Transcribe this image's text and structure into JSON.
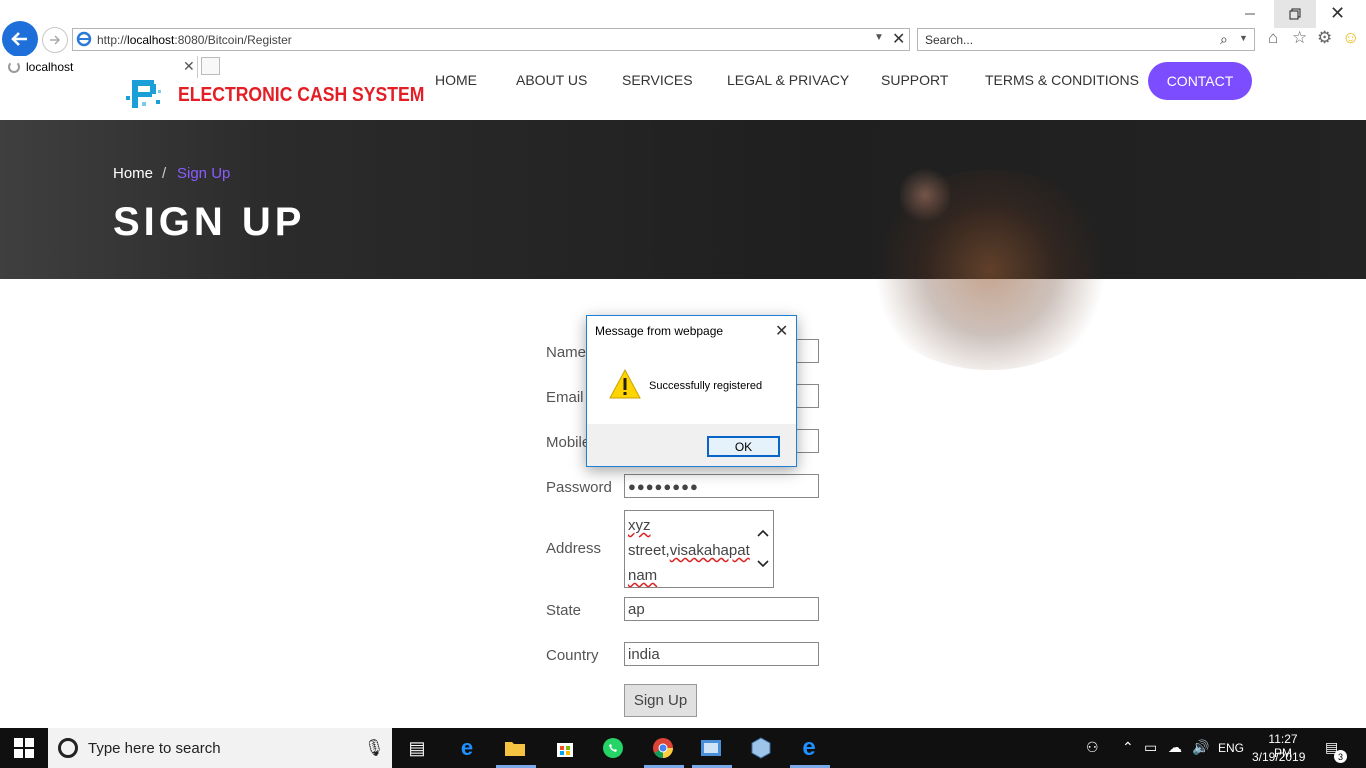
{
  "browser": {
    "url_prefix": "http://",
    "url_host": "localhost",
    "url_rest": ":8080/Bitcoin/Register",
    "search_placeholder": "Search...",
    "tab_title": "localhost"
  },
  "site": {
    "logo_text": "ELECTRONIC CASH SYSTEM",
    "nav": [
      "HOME",
      "ABOUT US",
      "SERVICES",
      "LEGAL & PRIVACY",
      "SUPPORT",
      "TERMS & CONDITIONS"
    ],
    "nav_contact": "CONTACT",
    "accent": "#7b4dff"
  },
  "hero": {
    "crumb_home": "Home",
    "crumb_sep": "/",
    "crumb_current": "Sign Up",
    "title": "SIGN UP"
  },
  "form": {
    "labels": {
      "name": "Name",
      "email": "Email",
      "mobile": "Mobile",
      "password": "Password",
      "address": "Address",
      "state": "State",
      "country": "Country"
    },
    "values": {
      "password_masked": "●●●●●●●●",
      "address_line1": "xyz",
      "address_line2a": "street,",
      "address_line2b": "visakahapat",
      "address_line3": "nam",
      "state": "ap",
      "country": "india"
    },
    "submit_label": "Sign Up"
  },
  "dialog": {
    "title": "Message from webpage",
    "message": "Successfully registered",
    "ok_label": "OK"
  },
  "taskbar": {
    "search_placeholder": "Type here to search",
    "lang": "ENG",
    "time": "11:27 PM",
    "date": "3/19/2019",
    "notif_count": "3"
  }
}
